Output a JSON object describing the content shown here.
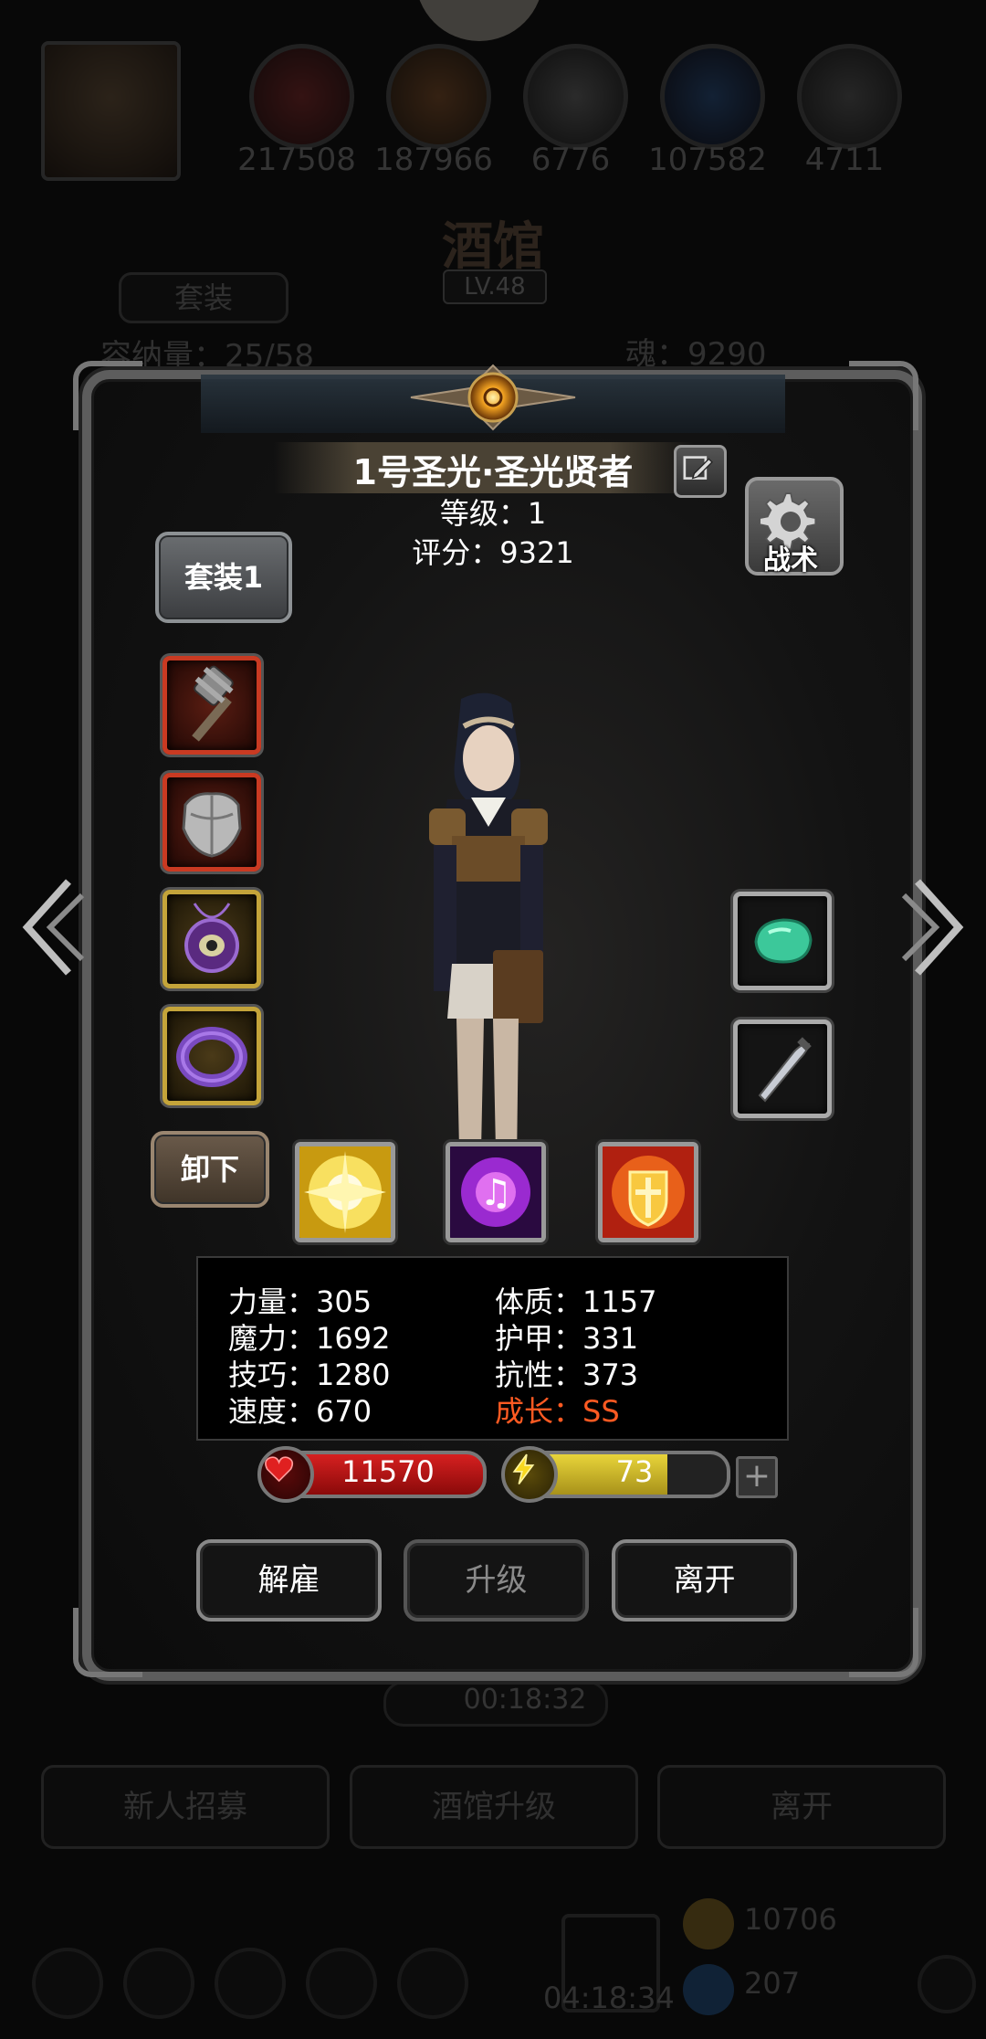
{
  "background": {
    "resources": [
      "217508",
      "187966",
      "6776",
      "107582",
      "4711"
    ],
    "tavern_title": "酒馆",
    "tavern_level": "LV.48",
    "set_tab": "套装",
    "capacity": "容纳量：25/58",
    "soul": "魂：9290",
    "timer": "00:18:32",
    "buttons": [
      "新人招募",
      "酒馆升级",
      "离开"
    ],
    "bottom_timer": "04:18:34",
    "bottom_counts": [
      "10706",
      "207"
    ]
  },
  "hero": {
    "name": "1号圣光·圣光贤者",
    "level": "等级：1",
    "score": "评分：9321",
    "tactics_label": "战术",
    "set_button": "套装1",
    "unequip_button": "卸下"
  },
  "equipment": {
    "left_slots": [
      {
        "item": "mace-icon",
        "rarity": "red"
      },
      {
        "item": "armor-icon",
        "rarity": "red"
      },
      {
        "item": "amulet-icon",
        "rarity": "gold"
      },
      {
        "item": "ring-icon",
        "rarity": "gold"
      }
    ],
    "right_slots": [
      {
        "item": "gem-icon",
        "rarity": "gray"
      },
      {
        "item": "dagger-icon",
        "rarity": "gray"
      }
    ]
  },
  "skills": [
    "holy-burst-icon",
    "arcane-music-icon",
    "holy-shield-icon"
  ],
  "stats": {
    "strength": "力量：305",
    "magic": "魔力：1692",
    "skill": "技巧：1280",
    "speed": "速度：670",
    "constitution": "体质：1157",
    "armor": "护甲：331",
    "resistance": "抗性：373",
    "growth": "成长：SS"
  },
  "bars": {
    "hp": "11570",
    "energy": "73",
    "energy_fraction": 0.73,
    "hp_color": "#d62020",
    "energy_color": "#e8d43a"
  },
  "actions": {
    "dismiss": "解雇",
    "upgrade": "升级",
    "leave": "离开"
  },
  "colors": {
    "growth": "#ff5a22",
    "panel_border": "#5d5d5d"
  }
}
